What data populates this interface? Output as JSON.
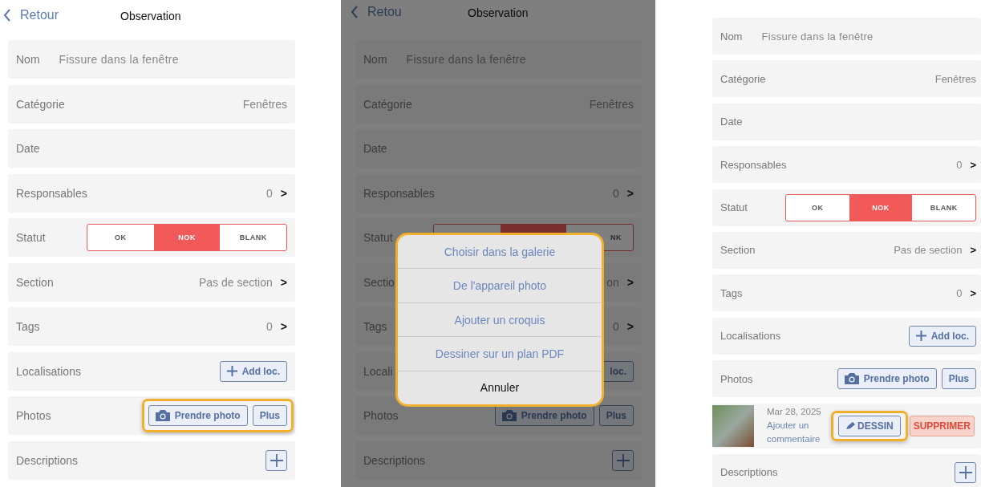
{
  "panels": [
    {
      "header": {
        "back": "Retour",
        "title": "Observation"
      },
      "rows": [
        {
          "kind": "text",
          "label": "Nom",
          "value": "Fissure dans la fenêtre"
        },
        {
          "kind": "value",
          "label": "Catégorie",
          "value": "Fenêtres"
        },
        {
          "kind": "value",
          "label": "Date"
        },
        {
          "kind": "link",
          "label": "Responsables",
          "value": "0",
          "chevron": ">"
        },
        {
          "kind": "status",
          "label": "Statut",
          "segments": [
            {
              "label": "OK",
              "selected": false
            },
            {
              "label": "NOK",
              "selected": true
            },
            {
              "label": "BLANK",
              "selected": false
            }
          ]
        },
        {
          "kind": "link",
          "label": "Section",
          "value": "Pas de section",
          "chevron": ">"
        },
        {
          "kind": "link",
          "label": "Tags",
          "value": "0",
          "chevron": ">"
        },
        {
          "kind": "add",
          "label": "Localisations",
          "button": "Add loc.",
          "plus": true
        },
        {
          "kind": "photos",
          "label": "Photos",
          "highlighted": true,
          "take": "Prendre photo",
          "more": "Plus"
        },
        {
          "kind": "plus",
          "label": "Descriptions"
        }
      ]
    },
    {
      "header": {
        "back": "Retou",
        "title": "Observation"
      },
      "dimmed": true,
      "rows": [
        {
          "kind": "text",
          "label": "Nom",
          "value": "Fissure dans la fenêtre"
        },
        {
          "kind": "value",
          "label": "Catégorie",
          "value": "Fenêtres"
        },
        {
          "kind": "value",
          "label": "Date"
        },
        {
          "kind": "link",
          "label": "Responsables",
          "value": "0",
          "chevron": ">"
        },
        {
          "kind": "status",
          "label": "Statut",
          "segments": [
            {
              "selected": false
            },
            {
              "selected": true
            },
            {
              "label": "NK",
              "selected": false
            }
          ]
        },
        {
          "kind": "link",
          "label": "Sectio",
          "value": "on",
          "chevron": ">"
        },
        {
          "kind": "link",
          "label": "Tags",
          "value": "0",
          "chevron": ">"
        },
        {
          "kind": "add",
          "label": "Locali",
          "button": "loc.",
          "plus": false
        },
        {
          "kind": "photos",
          "label": "Photos",
          "highlighted": false,
          "take": "Prendre photo",
          "more": "Plus"
        },
        {
          "kind": "plus",
          "label": "Descriptions"
        }
      ],
      "action_sheet": {
        "highlighted": true,
        "options": [
          "Choisir dans la galerie",
          "De l'appareil photo",
          "Ajouter un croquis",
          "Dessiner sur un plan PDF"
        ],
        "cancel": "Annuler"
      }
    },
    {
      "rows": [
        {
          "kind": "text",
          "label": "Nom",
          "value": "Fissure dans la fenêtre"
        },
        {
          "kind": "value",
          "label": "Catégorie",
          "value": "Fenêtres"
        },
        {
          "kind": "value",
          "label": "Date"
        },
        {
          "kind": "link",
          "label": "Responsables",
          "value": "0",
          "chevron": ">"
        },
        {
          "kind": "status",
          "label": "Statut",
          "segments": [
            {
              "label": "OK",
              "selected": false
            },
            {
              "label": "NOK",
              "selected": true
            },
            {
              "label": "BLANK",
              "selected": false
            }
          ]
        },
        {
          "kind": "link",
          "label": "Section",
          "value": "Pas de section",
          "chevron": ">"
        },
        {
          "kind": "link",
          "label": "Tags",
          "value": "0",
          "chevron": ">"
        },
        {
          "kind": "add",
          "label": "Localisations",
          "button": "Add loc.",
          "plus": true
        },
        {
          "kind": "photos",
          "label": "Photos",
          "highlighted": false,
          "take": "Prendre photo",
          "more": "Plus"
        },
        {
          "kind": "photo",
          "date": "Mar 28, 2025",
          "comment": "Ajouter un commentaire",
          "draw": "DESSIN",
          "draw_highlighted": true,
          "delete": "SUPPRIMER"
        },
        {
          "kind": "plus",
          "label": "Descriptions"
        }
      ]
    }
  ]
}
